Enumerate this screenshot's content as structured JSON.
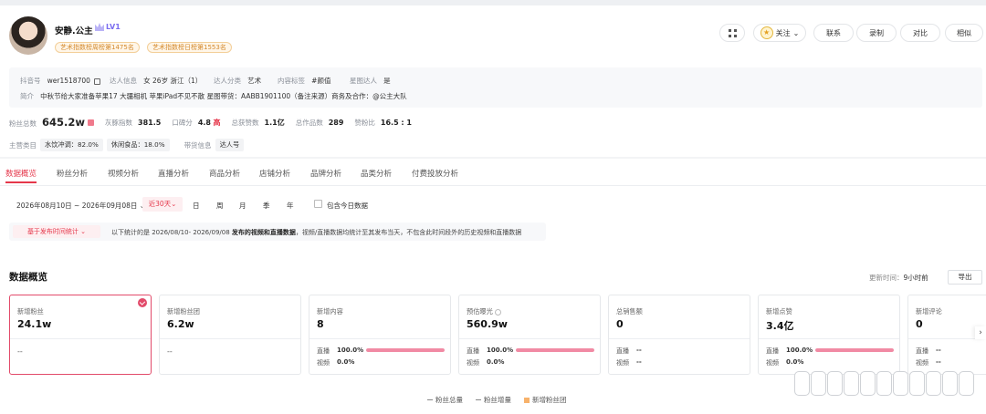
{
  "profile": {
    "name": "安静.公主",
    "level": "LV1",
    "rank_badges": [
      "艺术指数榜周榜第1475名",
      "艺术指数榜日榜第1553名"
    ],
    "buttons": {
      "follow": "关注",
      "contact": "联系",
      "record": "录制",
      "compare": "对比",
      "similar": "相似"
    },
    "douyin_label": "抖音号",
    "douyin_value": "wer1518700",
    "talent_info_label": "达人信息",
    "talent_info_value": "女 26岁 浙江（1）",
    "talent_cat_label": "达人分类",
    "talent_cat_value": "艺术",
    "content_tag_label": "内容标签",
    "content_tag_value": "#颜值",
    "xingtu_label": "星图达人",
    "xingtu_value": "是",
    "bio_label": "简介",
    "bio_value": "中秋节给大家准备苹果17 大疆相机 苹果iPad不见不散 星图带货：AABB1901100（备注来源）商务及合作：@公主大队",
    "stats": [
      {
        "label": "粉丝总数",
        "value": "645.2w"
      },
      {
        "label": "灰豚指数",
        "value": "381.5"
      },
      {
        "label": "口碑分",
        "value": "4.8",
        "extra": "高"
      },
      {
        "label": "总获赞数",
        "value": "1.1亿"
      },
      {
        "label": "总作品数",
        "value": "289"
      },
      {
        "label": "赞粉比",
        "value": "16.5 : 1"
      }
    ],
    "main_cat_label": "主营类目",
    "main_cats": [
      "水饮冲调：82.0%",
      "休闲食品：18.0%"
    ],
    "goods_label": "带货信息",
    "goods_value": "达人号"
  },
  "tabs": [
    "数据概览",
    "粉丝分析",
    "视频分析",
    "直播分析",
    "商品分析",
    "店铺分析",
    "品牌分析",
    "品类分析",
    "付费投放分析"
  ],
  "filters": {
    "date_range": "2026年08月10日 ~ 2026年09月08日",
    "range_chip": "近30天",
    "periods": [
      "日",
      "周",
      "月",
      "季",
      "年"
    ],
    "include_today": "包含今日数据"
  },
  "notice": {
    "chip": "基于发布时间统计",
    "text_a": "以下统计的是 2026/08/10- 2026/09/08",
    "text_b": "发布的视频和直播数据",
    "text_c": "，视频/直播数据均统计至其发布当天，不包含此时间段外的历史视频和直播数据"
  },
  "overview": {
    "title": "数据概览",
    "update_label": "更新时间：",
    "update_value": "9小时前",
    "export": "导出"
  },
  "cards": [
    {
      "title": "新增粉丝",
      "value": "24.1w",
      "dash": "--"
    },
    {
      "title": "新增粉丝团",
      "value": "6.2w",
      "dash": "--"
    },
    {
      "title": "新增内容",
      "value": "8",
      "live_label": "直播",
      "live_pct": "100.0%",
      "live_fill": 100,
      "video_label": "视频",
      "video_pct": "0.0%"
    },
    {
      "title": "预估曝光",
      "value": "560.9w",
      "live_label": "直播",
      "live_pct": "100.0%",
      "live_fill": 100,
      "video_label": "视频",
      "video_pct": "0.0%"
    },
    {
      "title": "总销售额",
      "value": "0",
      "live_label": "直播",
      "live_pct": "--",
      "video_label": "视频",
      "video_pct": "--"
    },
    {
      "title": "新增点赞",
      "value": "3.4亿",
      "live_label": "直播",
      "live_pct": "100.0%",
      "live_fill": 100,
      "video_label": "视频",
      "video_pct": "0.0%"
    },
    {
      "title": "新增评论",
      "value": "0",
      "live_label": "直播",
      "live_pct": "--",
      "video_label": "视频",
      "video_pct": "--"
    }
  ],
  "legend": [
    "粉丝总量",
    "粉丝增量",
    "新增粉丝团"
  ],
  "colors": {
    "accent": "#e5374b",
    "progress": "#f18aa4",
    "rank": "#d48a2e"
  }
}
